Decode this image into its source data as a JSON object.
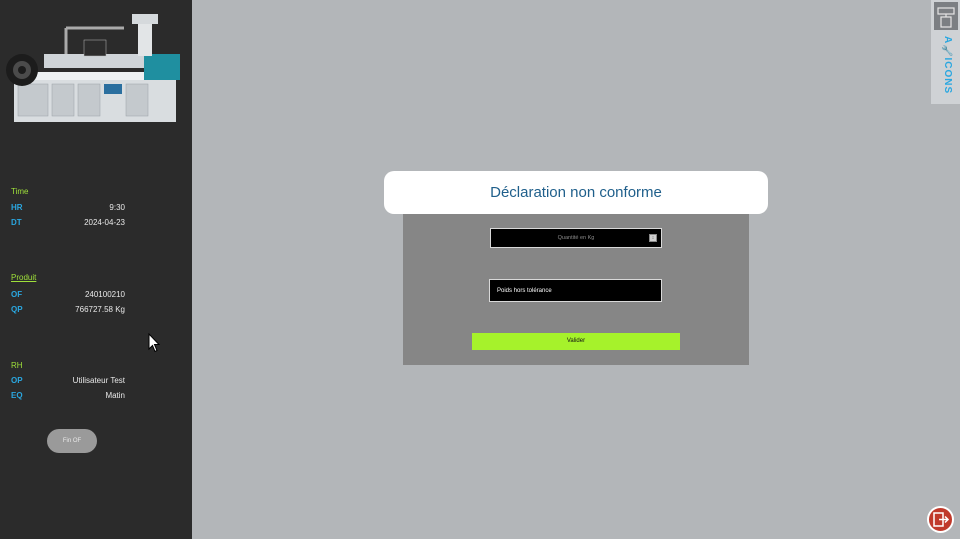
{
  "sidebar": {
    "time_section": {
      "title": "Time",
      "rows": [
        {
          "key": "HR",
          "value": "9:30"
        },
        {
          "key": "DT",
          "value": "2024-04-23"
        }
      ]
    },
    "produit_section": {
      "title": "Produit",
      "rows": [
        {
          "key": "OF",
          "value": "240100210"
        },
        {
          "key": "QP",
          "value": "766727.58 Kg"
        }
      ]
    },
    "rh_section": {
      "title": "RH",
      "rows": [
        {
          "key": "OP",
          "value": "Utilisateur Test"
        },
        {
          "key": "EQ",
          "value": "Matin"
        }
      ]
    },
    "fin_of_label": "Fin OF"
  },
  "icons_tab": {
    "label": "ICONS",
    "letter": "A"
  },
  "dialog": {
    "title": "Déclaration non conforme",
    "quantity_placeholder": "Quantité en Kg",
    "reason_value": "Poids hors tolérance",
    "submit_label": "Valider"
  },
  "colors": {
    "accent_blue": "#2aa7e0",
    "section_green": "#9fe03a",
    "submit_green": "#a6f22b",
    "title_blue": "#1f5f8b"
  }
}
